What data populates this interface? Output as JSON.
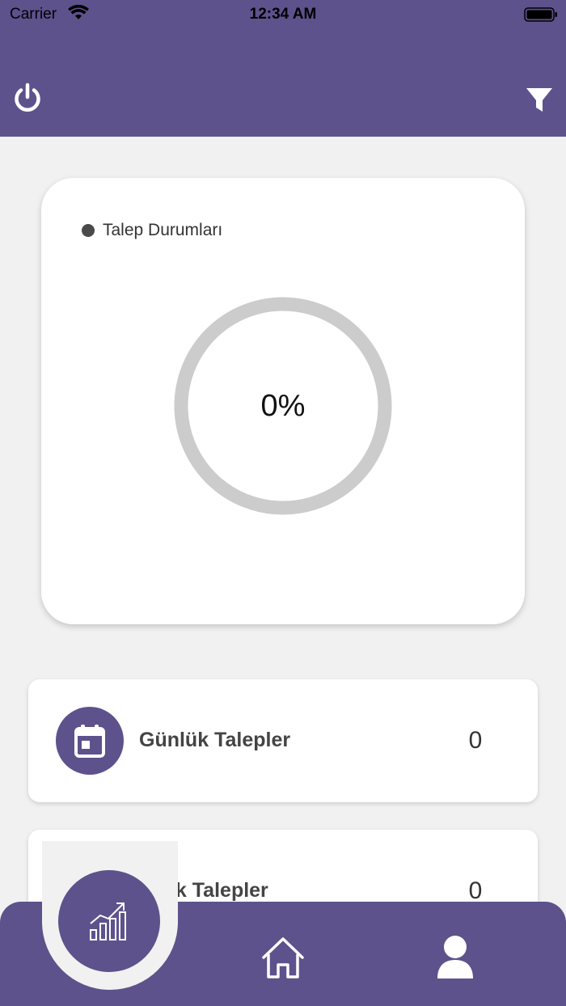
{
  "status_bar": {
    "carrier": "Carrier",
    "time": "12:34 AM"
  },
  "header": {
    "background": "#5d528c",
    "left_icon": "power-icon",
    "right_icon": "filter-icon"
  },
  "chart_card": {
    "legend": {
      "label": "Talep Durumları",
      "dot_color": "#4a4a4a"
    },
    "progress": {
      "percent_text": "0%",
      "value": 0,
      "track_color": "#cccccc"
    }
  },
  "cards": [
    {
      "label": "Günlük Talepler",
      "value": "0",
      "icon": "calendar-icon",
      "color": "#5d528c"
    },
    {
      "label": "Aylık Talepler",
      "value": "0",
      "icon": "calendar-icon",
      "color": "#e07a6a"
    }
  ],
  "nav": {
    "items": [
      "chart-icon",
      "home-icon",
      "profile-icon"
    ],
    "active": "chart-icon",
    "color": "#5d528c"
  }
}
